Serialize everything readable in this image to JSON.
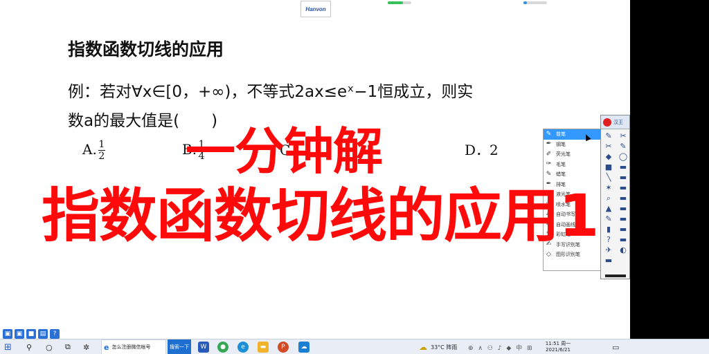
{
  "header": {
    "logo_text": "Hanvon",
    "slider_1_level": 0.65,
    "slider_2_level": 0.15
  },
  "document": {
    "title": "指数函数切线的应用",
    "line1": "例：若对∀x∈[0，+∞)，不等式2ax≤eˣ−1恒成立，则实",
    "line2": "数a的最大值是(　　)",
    "options": {
      "a_prefix": "A.",
      "a_num": "1",
      "a_den": "2",
      "b_prefix": "B.",
      "b_num": "1",
      "b_den": "4",
      "c_text": "C．1",
      "d_text": "D．2"
    }
  },
  "overlay": {
    "line1": "一分钟解",
    "line2": "指数函数切线的应用1"
  },
  "pen_menu": {
    "items": [
      {
        "label": "普笔",
        "icon": "pen-icon",
        "glyph": "✎"
      },
      {
        "label": "钢笔",
        "icon": "fountain-pen-icon",
        "glyph": "✒"
      },
      {
        "label": "荧光笔",
        "icon": "highlighter-icon",
        "glyph": "✐"
      },
      {
        "label": "毛笔",
        "icon": "brush-icon",
        "glyph": "✑"
      },
      {
        "label": "蜡笔",
        "icon": "crayon-icon",
        "glyph": "✎"
      },
      {
        "label": "排笔",
        "icon": "flat-brush-icon",
        "glyph": "✒"
      },
      {
        "label": "液光笔",
        "icon": "glow-pen-icon",
        "glyph": "✐"
      },
      {
        "label": "喷水笔",
        "icon": "spray-pen-icon",
        "glyph": "✑"
      },
      {
        "label": "自动书写笔",
        "icon": "auto-pen-icon",
        "glyph": "✍"
      },
      {
        "label": "自动画线笔",
        "icon": "line-pen-icon",
        "glyph": "✍"
      },
      {
        "label": "彩虹笔",
        "icon": "rainbow-pen-icon",
        "glyph": "✎"
      },
      {
        "label": "手写识别笔",
        "icon": "handwriting-pen-icon",
        "glyph": "✍"
      },
      {
        "label": "图形识别笔",
        "icon": "shape-pen-icon",
        "glyph": "◇"
      }
    ]
  },
  "toolbox": {
    "header_label": "汉王",
    "icons": [
      "✎",
      "✂",
      "✂",
      "✎",
      "◆",
      "◯",
      "■",
      "▬",
      "╲",
      "▬",
      "✶",
      "▬",
      "⌕",
      "▬",
      "▲",
      "▬",
      "✎",
      "▬",
      "▮",
      "▬",
      "?",
      "▬",
      "✈",
      "◐",
      "▬"
    ]
  },
  "mini_toolbar": {
    "icons": [
      "▣",
      "▣",
      "■",
      "▤",
      "?"
    ]
  },
  "taskbar": {
    "start_glyph": "⊞",
    "search_glyph": "⚲",
    "cortana_glyph": "○",
    "taskview_glyph": "⧉",
    "settings_glyph": "✲",
    "browser_icon": "e",
    "browser_text": "怎么注册微信帐号",
    "search_button": "搜索一下",
    "apps": [
      "W",
      "●",
      "e",
      "▬",
      "P",
      "☁"
    ],
    "weather_icon": "☁",
    "weather_text": "33°C 阵雨",
    "tray_icons": "⊕ ∧ ⚇ ♪ ◆ 中 ⊞",
    "time": "11:51 周一",
    "date": "2021/6/21",
    "notify_glyph": "▭"
  }
}
